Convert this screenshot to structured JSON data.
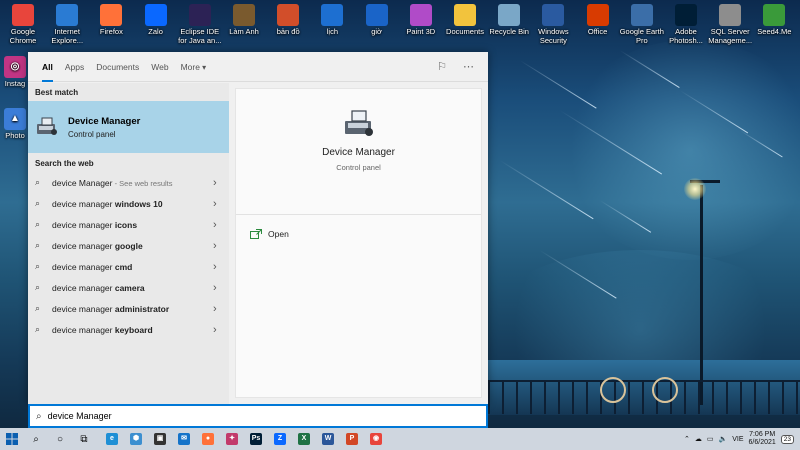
{
  "desktop": {
    "icons": [
      {
        "label": "Google Chrome",
        "icon": "chrome-icon",
        "color": "#e8453c"
      },
      {
        "label": "Internet Explore...",
        "icon": "internet-explorer-icon",
        "color": "#2a7bd3"
      },
      {
        "label": "Firefox",
        "icon": "firefox-icon",
        "color": "#ff7139"
      },
      {
        "label": "Zalo",
        "icon": "zalo-icon",
        "color": "#0a68ff"
      },
      {
        "label": "Eclipse IDE for Java an...",
        "icon": "eclipse-icon",
        "color": "#2c2255"
      },
      {
        "label": "Làm Anh",
        "icon": "photo-icon",
        "color": "#7a5a2e"
      },
      {
        "label": "bản đồ",
        "icon": "maps-icon",
        "color": "#d24e2a"
      },
      {
        "label": "lịch",
        "icon": "calendar-icon",
        "color": "#1d6fd1"
      },
      {
        "label": "giờ",
        "icon": "clock-icon",
        "color": "#1a64c8"
      },
      {
        "label": "Paint 3D",
        "icon": "paint3d-icon",
        "color": "#b04bc8"
      },
      {
        "label": "Documents",
        "icon": "folder-icon",
        "color": "#f2c33d"
      },
      {
        "label": "Recycle Bin",
        "icon": "recycle-bin-icon",
        "color": "#7aa7c7"
      },
      {
        "label": "Windows Security",
        "icon": "windows-security-icon",
        "color": "#2a5aa0"
      },
      {
        "label": "Office",
        "icon": "office-icon",
        "color": "#d83b01"
      },
      {
        "label": "Google Earth Pro",
        "icon": "google-earth-icon",
        "color": "#3b6ea8"
      },
      {
        "label": "Adobe Photosh...",
        "icon": "photoshop-icon",
        "color": "#001e36"
      },
      {
        "label": "SQL Server Manageme...",
        "icon": "sql-server-icon",
        "color": "#8d8d8d"
      },
      {
        "label": "Seed4.Me",
        "icon": "seed4me-icon",
        "color": "#3a9a3a"
      }
    ],
    "side_icons": [
      {
        "label": "Instag",
        "icon": "instagram-icon",
        "color": "#c13584"
      },
      {
        "label": "Photo",
        "icon": "photo-icon",
        "color": "#3b7dd8"
      }
    ]
  },
  "search_panel": {
    "tabs": [
      {
        "label": "All"
      },
      {
        "label": "Apps"
      },
      {
        "label": "Documents"
      },
      {
        "label": "Web"
      },
      {
        "label": "More"
      }
    ],
    "best_match_heading": "Best match",
    "best_match": {
      "title": "Device Manager",
      "subtitle": "Control panel"
    },
    "web_heading": "Search the web",
    "web_results": [
      {
        "prefix": "device Manager",
        "bold": "",
        "hint": " - See web results"
      },
      {
        "prefix": "device manager ",
        "bold": "windows 10",
        "hint": ""
      },
      {
        "prefix": "device manager ",
        "bold": "icons",
        "hint": ""
      },
      {
        "prefix": "device manager ",
        "bold": "google",
        "hint": ""
      },
      {
        "prefix": "device manager ",
        "bold": "cmd",
        "hint": ""
      },
      {
        "prefix": "device manager ",
        "bold": "camera",
        "hint": ""
      },
      {
        "prefix": "device manager ",
        "bold": "administrator",
        "hint": ""
      },
      {
        "prefix": "device manager ",
        "bold": "keyboard",
        "hint": ""
      }
    ],
    "detail": {
      "title": "Device Manager",
      "subtitle": "Control panel",
      "action_open": "Open"
    }
  },
  "search_box": {
    "value": "device Manager"
  },
  "taskbar": {
    "apps": [
      {
        "icon": "edge-icon",
        "color": "#1e8fd5",
        "glyph": "e"
      },
      {
        "icon": "network-app-icon",
        "color": "#3c8fd0",
        "glyph": "⬢"
      },
      {
        "icon": "store-icon",
        "color": "#333333",
        "glyph": "▣"
      },
      {
        "icon": "mail-icon",
        "color": "#1473c9",
        "glyph": "✉"
      },
      {
        "icon": "firefox-icon",
        "color": "#ff7139",
        "glyph": "●"
      },
      {
        "icon": "app-icon",
        "color": "#c23a6b",
        "glyph": "✦"
      },
      {
        "icon": "photoshop-icon",
        "color": "#001e36",
        "glyph": "Ps"
      },
      {
        "icon": "zalo-icon",
        "color": "#0a68ff",
        "glyph": "Z"
      },
      {
        "icon": "excel-icon",
        "color": "#1f7244",
        "glyph": "X"
      },
      {
        "icon": "word-icon",
        "color": "#2b579a",
        "glyph": "W"
      },
      {
        "icon": "powerpoint-icon",
        "color": "#d24726",
        "glyph": "P"
      },
      {
        "icon": "chrome-icon",
        "color": "#e8453c",
        "glyph": "◉"
      }
    ],
    "language": "VIE",
    "time": "7:06 PM",
    "date": "6/6/2021",
    "notification_count": "23"
  }
}
